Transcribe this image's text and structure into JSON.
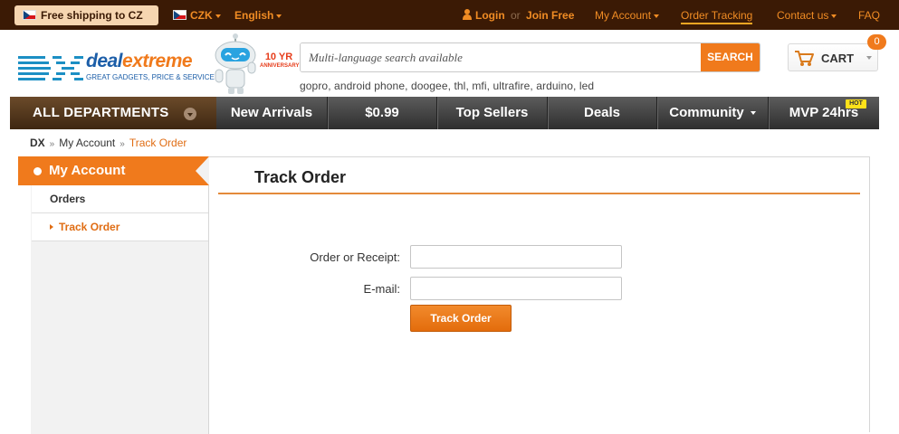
{
  "topbar": {
    "shipping": "Free shipping to CZ",
    "currency": "CZK",
    "language": "English",
    "login": "Login",
    "or": "or",
    "join": "Join Free",
    "my_account": "My Account",
    "order_tracking": "Order Tracking",
    "contact": "Contact us",
    "faq": "FAQ"
  },
  "header": {
    "logo_letters": "DX",
    "logo_word_1": "deal",
    "logo_word_2": "extreme",
    "logo_tagline": "GREAT GADGETS, PRICE & SERVICE",
    "anniversary_big": "10 YR",
    "anniversary_small": "ANNIVERSARY",
    "search_placeholder": "Multi-language search available",
    "search_button": "SEARCH",
    "suggestions": "gopro, android phone, doogee, thl, mfi, ultrafire, arduino, led",
    "cart_label": "CART",
    "cart_count": "0"
  },
  "nav": {
    "all_departments": "ALL DEPARTMENTS",
    "items": [
      "New Arrivals",
      "$0.99",
      "Top Sellers",
      "Deals",
      "Community",
      "MVP 24hrs"
    ],
    "hot_badge": "HOT"
  },
  "breadcrumb": {
    "root": "DX",
    "separator": "»",
    "account": "My Account",
    "current": "Track Order"
  },
  "sidebar": {
    "heading": "My Account",
    "items": [
      "Orders",
      "Track Order"
    ]
  },
  "main": {
    "title": "Track Order",
    "order_label": "Order or Receipt:",
    "email_label": "E-mail:",
    "order_value": "",
    "email_value": "",
    "submit": "Track Order"
  },
  "colors": {
    "accent": "#f07a1c",
    "topbar_bg": "#3b1a05",
    "brand_blue": "#1c5ea8"
  }
}
